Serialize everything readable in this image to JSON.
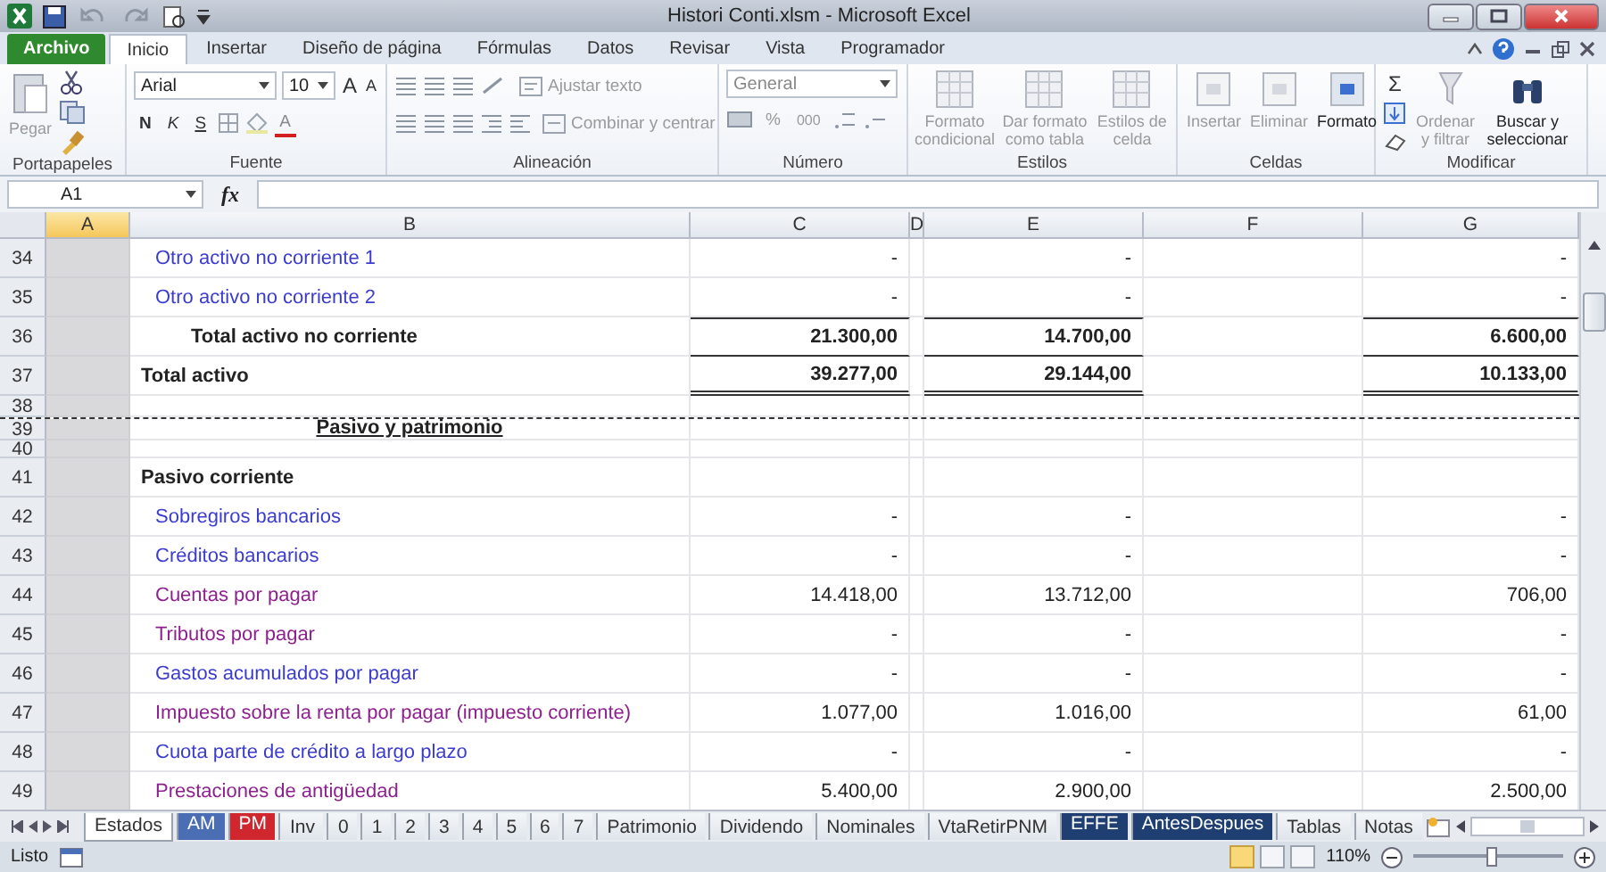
{
  "window": {
    "title": "Histori Conti.xlsm - Microsoft Excel"
  },
  "ribbon_tabs": [
    {
      "label": "Archivo",
      "kind": "file",
      "selected": false
    },
    {
      "label": "Inicio",
      "kind": "tab",
      "selected": true
    },
    {
      "label": "Insertar",
      "kind": "tab",
      "selected": false
    },
    {
      "label": "Diseño de página",
      "kind": "tab",
      "selected": false
    },
    {
      "label": "Fórmulas",
      "kind": "tab",
      "selected": false
    },
    {
      "label": "Datos",
      "kind": "tab",
      "selected": false
    },
    {
      "label": "Revisar",
      "kind": "tab",
      "selected": false
    },
    {
      "label": "Vista",
      "kind": "tab",
      "selected": false
    },
    {
      "label": "Programador",
      "kind": "tab",
      "selected": false
    }
  ],
  "ribbon_groups": [
    {
      "kind": "clipboard",
      "label": "Portapapeles",
      "paste": {
        "label": "Pegar",
        "disabled": true
      }
    },
    {
      "kind": "font",
      "label": "Fuente",
      "font": "Arial",
      "size": "10",
      "grow": "A",
      "shrink": "A",
      "bold": "N",
      "italic": "K",
      "underline": "S",
      "font_color": "A"
    },
    {
      "kind": "alignment",
      "label": "Alineación",
      "wrap": {
        "label": "Ajustar texto",
        "disabled": true
      },
      "merge": {
        "label": "Combinar y centrar",
        "disabled": true
      }
    },
    {
      "kind": "number",
      "label": "Número",
      "format": "General",
      "percent": "%",
      "thousands": "000"
    },
    {
      "kind": "styles",
      "label": "Estilos",
      "buttons": [
        {
          "label": "Formato condicional",
          "disabled": true
        },
        {
          "label": "Dar formato como tabla",
          "disabled": true
        },
        {
          "label": "Estilos de celda",
          "disabled": true
        }
      ]
    },
    {
      "kind": "cells",
      "label": "Celdas",
      "buttons": [
        {
          "label": "Insertar",
          "disabled": true
        },
        {
          "label": "Eliminar",
          "disabled": true
        },
        {
          "label": "Formato",
          "disabled": false
        }
      ]
    },
    {
      "kind": "editing",
      "label": "Modificar",
      "sum": "Σ",
      "buttons": [
        {
          "label": "Ordenar y filtrar",
          "disabled": true
        },
        {
          "label": "Buscar y seleccionar",
          "disabled": false
        }
      ]
    }
  ],
  "formula_bar": {
    "name_box": "A1",
    "fx": "fx"
  },
  "columns": [
    {
      "label": "A",
      "selected": true
    },
    {
      "label": "B",
      "selected": false
    },
    {
      "label": "C",
      "selected": false
    },
    {
      "label": "D",
      "selected": false
    },
    {
      "label": "E",
      "selected": false
    },
    {
      "label": "F",
      "selected": false
    },
    {
      "label": "G",
      "selected": false
    }
  ],
  "rows": [
    {
      "num": "34",
      "kind": "item",
      "label": "Otro activo no corriente 1",
      "color": "#3b3bd0",
      "values": [
        "-",
        "-",
        "-"
      ]
    },
    {
      "num": "35",
      "kind": "item",
      "label": "Otro activo no corriente 2",
      "color": "#3b3bd0",
      "values": [
        "-",
        "-",
        "-"
      ]
    },
    {
      "num": "36",
      "kind": "subtotal",
      "label": "Total activo no corriente",
      "values": [
        "21.300,00",
        "14.700,00",
        "6.600,00"
      ]
    },
    {
      "num": "37",
      "kind": "total",
      "label": "Total activo",
      "values": [
        "39.277,00",
        "29.144,00",
        "10.133,00"
      ]
    },
    {
      "num": "38",
      "kind": "spacer",
      "page_break": true
    },
    {
      "num": "39",
      "kind": "heading",
      "label": "Pasivo y patrimonio"
    },
    {
      "num": "40",
      "kind": "blank"
    },
    {
      "num": "41",
      "kind": "section",
      "label": "Pasivo corriente"
    },
    {
      "num": "42",
      "kind": "item",
      "label": "Sobregiros bancarios",
      "color": "#3b3bd0",
      "values": [
        "-",
        "-",
        "-"
      ]
    },
    {
      "num": "43",
      "kind": "item",
      "label": "Créditos bancarios",
      "color": "#3b3bd0",
      "values": [
        "-",
        "-",
        "-"
      ]
    },
    {
      "num": "44",
      "kind": "item",
      "label": "Cuentas por pagar",
      "color": "#8e1f8e",
      "values": [
        "14.418,00",
        "13.712,00",
        "706,00"
      ]
    },
    {
      "num": "45",
      "kind": "item",
      "label": "Tributos por pagar",
      "color": "#8e1f8e",
      "values": [
        "-",
        "-",
        "-"
      ]
    },
    {
      "num": "46",
      "kind": "item",
      "label": "Gastos acumulados por pagar",
      "color": "#3b3bd0",
      "values": [
        "-",
        "-",
        "-"
      ]
    },
    {
      "num": "47",
      "kind": "item",
      "label": "Impuesto sobre la renta por pagar (impuesto corriente)",
      "color": "#8e1f8e",
      "values": [
        "1.077,00",
        "1.016,00",
        "61,00"
      ]
    },
    {
      "num": "48",
      "kind": "item",
      "label": "Cuota parte de crédito a largo plazo",
      "color": "#3b3bd0",
      "values": [
        "-",
        "-",
        "-"
      ]
    },
    {
      "num": "49",
      "kind": "item",
      "label": "Prestaciones de antigüedad",
      "color": "#8e1f8e",
      "values": [
        "5.400,00",
        "2.900,00",
        "2.500,00"
      ]
    }
  ],
  "sheet_tabs": [
    {
      "label": "Estados",
      "selected": true
    },
    {
      "label": "AM",
      "selected": false,
      "color": "#4a6db4"
    },
    {
      "label": "PM",
      "selected": false,
      "color": "#d0262e"
    },
    {
      "label": "Inv",
      "selected": false
    },
    {
      "label": "0",
      "selected": false
    },
    {
      "label": "1",
      "selected": false
    },
    {
      "label": "2",
      "selected": false
    },
    {
      "label": "3",
      "selected": false
    },
    {
      "label": "4",
      "selected": false
    },
    {
      "label": "5",
      "selected": false
    },
    {
      "label": "6",
      "selected": false
    },
    {
      "label": "7",
      "selected": false
    },
    {
      "label": "Patrimonio",
      "selected": false
    },
    {
      "label": "Dividendo",
      "selected": false
    },
    {
      "label": "Nominales",
      "selected": false
    },
    {
      "label": "VtaRetirPNM",
      "selected": false
    },
    {
      "label": "EFFE",
      "selected": false,
      "color": "#1f3f73"
    },
    {
      "label": "AntesDespues",
      "selected": false,
      "color": "#1f3f73"
    },
    {
      "label": "Tablas",
      "selected": false
    },
    {
      "label": "Notas",
      "selected": false
    }
  ],
  "status_bar": {
    "text": "Listo",
    "zoom": "110%",
    "zoom_slider": {
      "level": 0.52
    }
  }
}
